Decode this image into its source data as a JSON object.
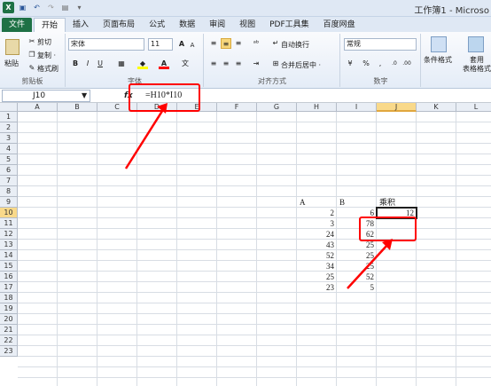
{
  "window": {
    "title": "工作簿1 - Microso"
  },
  "ribbon_tabs": [
    "文件",
    "开始",
    "插入",
    "页面布局",
    "公式",
    "数据",
    "审阅",
    "视图",
    "PDF工具集",
    "百度网盘"
  ],
  "ribbon": {
    "clipboard": {
      "cut": "剪切",
      "copy": "复制 ·",
      "paste": "粘贴",
      "format_painter": "格式刷",
      "label": "剪贴板"
    },
    "font": {
      "name": "宋体",
      "size": "11",
      "label": "字体",
      "bold": "B",
      "italic": "I",
      "underline": "U"
    },
    "alignment": {
      "wrap": "自动换行",
      "merge": "合并后居中 ·",
      "label": "对齐方式"
    },
    "number": {
      "format": "常规",
      "percent": "%",
      "comma": ",",
      "label": "数字"
    },
    "styles": {
      "conditional": "条件格式",
      "table": "套用",
      "table2": "表格格式"
    }
  },
  "formula_bar": {
    "name_box": "J10",
    "fx": "fx",
    "formula": "=H10*I10"
  },
  "columns": [
    "A",
    "B",
    "C",
    "D",
    "E",
    "F",
    "G",
    "H",
    "I",
    "J",
    "K",
    "L"
  ],
  "rows": [
    "1",
    "2",
    "3",
    "4",
    "5",
    "6",
    "7",
    "8",
    "9",
    "10",
    "11",
    "12",
    "13",
    "14",
    "15",
    "16",
    "17",
    "18",
    "19",
    "20",
    "21",
    "22",
    "23"
  ],
  "headers_row9": {
    "H": "A",
    "I": "B",
    "J": "乘积"
  },
  "data": [
    {
      "row": "10",
      "H": "2",
      "I": "6",
      "J": "12"
    },
    {
      "row": "11",
      "H": "3",
      "I": "78",
      "J": ""
    },
    {
      "row": "12",
      "H": "24",
      "I": "62",
      "J": ""
    },
    {
      "row": "13",
      "H": "43",
      "I": "25",
      "J": ""
    },
    {
      "row": "14",
      "H": "52",
      "I": "25",
      "J": ""
    },
    {
      "row": "15",
      "H": "34",
      "I": "25",
      "J": ""
    },
    {
      "row": "16",
      "H": "25",
      "I": "52",
      "J": ""
    },
    {
      "row": "17",
      "H": "23",
      "I": "5",
      "J": ""
    }
  ],
  "colors": {
    "annotation": "#ff0000",
    "file_tab": "#1e7145",
    "selection": "#f9d98a"
  }
}
